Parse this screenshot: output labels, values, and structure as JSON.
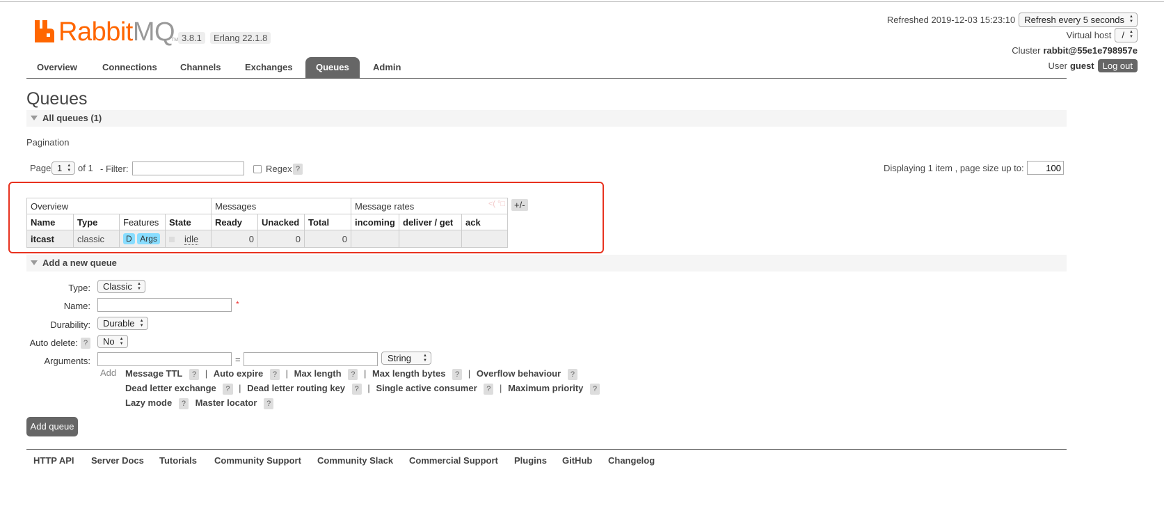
{
  "brand": {
    "logo_rabbit": "Rabbit",
    "logo_mq": "MQ",
    "tm": "TM",
    "version": "3.8.1",
    "erlang": "Erlang 22.1.8"
  },
  "header": {
    "refreshed_label": "Refreshed 2019-12-03 15:23:10",
    "refresh_select": "Refresh every 5 seconds",
    "vhost_label": "Virtual host",
    "vhost_value": "/",
    "cluster_label": "Cluster",
    "cluster_value": "rabbit@55e1e798957e",
    "user_label": "User",
    "user_value": "guest",
    "logout": "Log out"
  },
  "tabs": [
    "Overview",
    "Connections",
    "Channels",
    "Exchanges",
    "Queues",
    "Admin"
  ],
  "page": {
    "title": "Queues",
    "all_queues": "All queues (1)",
    "pagination": "Pagination",
    "page_label": "Page",
    "page_value": "1",
    "of_label": "of 1",
    "filter_label": "- Filter:",
    "regex_label": "Regex",
    "help": "?",
    "displaying": "Displaying 1 item , page size up to:",
    "page_size": "100"
  },
  "table": {
    "groups": [
      "Overview",
      "Messages",
      "Message rates"
    ],
    "columns": [
      "Name",
      "Type",
      "Features",
      "State",
      "Ready",
      "Unacked",
      "Total",
      "incoming",
      "deliver / get",
      "ack"
    ],
    "rows": [
      {
        "name": "itcast",
        "type": "classic",
        "feat_d": "D",
        "feat_args": "Args",
        "state": "idle",
        "ready": "0",
        "unacked": "0",
        "total": "0"
      }
    ],
    "plusminus": "+/-",
    "faint_mark": "<( °□"
  },
  "add_queue": {
    "section": "Add a new queue",
    "type_label": "Type:",
    "type_value": "Classic",
    "name_label": "Name:",
    "durability_label": "Durability:",
    "durability_value": "Durable",
    "auto_delete_label": "Auto delete:",
    "auto_delete_value": "No",
    "arguments_label": "Arguments:",
    "equals": "=",
    "arg_type_value": "String",
    "add_link": "Add",
    "required_mark": "*",
    "sep": "|",
    "arg_line1": [
      "Message TTL",
      "Auto expire",
      "Max length",
      "Max length bytes",
      "Overflow behaviour"
    ],
    "arg_line2": [
      "Dead letter exchange",
      "Dead letter routing key",
      "Single active consumer",
      "Maximum priority"
    ],
    "arg_line3": [
      "Lazy mode",
      "Master locator"
    ],
    "submit": "Add queue"
  },
  "footer": [
    "HTTP API",
    "Server Docs",
    "Tutorials",
    "Community Support",
    "Community Slack",
    "Commercial Support",
    "Plugins",
    "GitHub",
    "Changelog"
  ],
  "colors": {
    "brand_orange": "#ff6600",
    "tab_active": "#666666",
    "highlight_red": "#e8321f",
    "feature_tag": "#88ddff"
  }
}
